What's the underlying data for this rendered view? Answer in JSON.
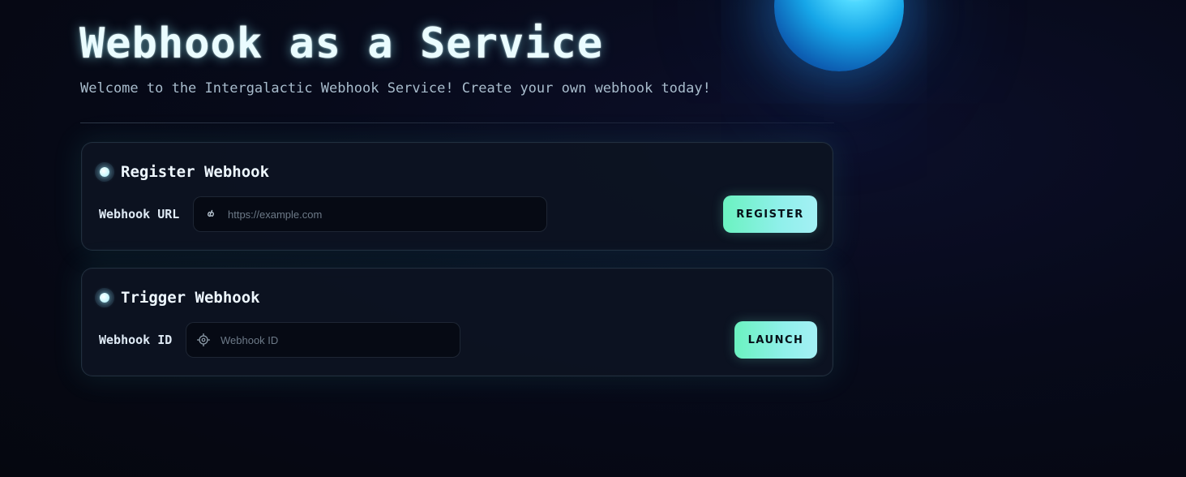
{
  "header": {
    "title": "Webhook as a Service",
    "subtitle": "Welcome to the Intergalactic Webhook Service! Create your own webhook today!"
  },
  "register_card": {
    "title": "Register Webhook",
    "field_label": "Webhook URL",
    "input_placeholder": "https://example.com",
    "input_value": "",
    "input_icon": "link-icon",
    "button_label": "REGISTER"
  },
  "trigger_card": {
    "title": "Trigger Webhook",
    "field_label": "Webhook ID",
    "input_placeholder": "Webhook ID",
    "input_value": "",
    "input_icon": "target-icon",
    "button_label": "LAUNCH"
  },
  "colors": {
    "accent_gradient_start": "#6bf2c0",
    "accent_gradient_end": "#a4f0f5",
    "background": "#070a1a",
    "orb": "#16a6e8"
  }
}
